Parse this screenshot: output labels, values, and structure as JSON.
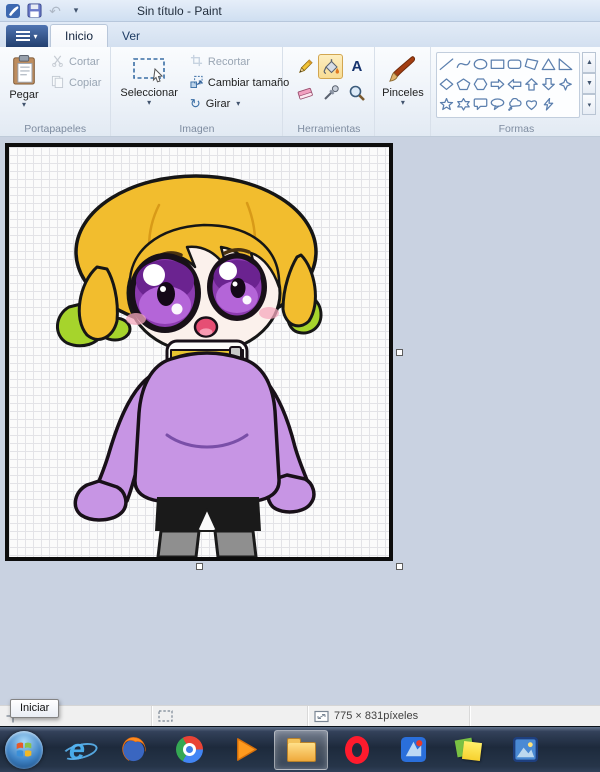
{
  "titlebar": {
    "title": "Sin título - Paint"
  },
  "ribbon": {
    "tabs": [
      {
        "label": "Inicio",
        "active": true
      },
      {
        "label": "Ver",
        "active": false
      }
    ],
    "clipboard": {
      "label": "Portapapeles",
      "paste": "Pegar",
      "cut": "Cortar",
      "copy": "Copiar"
    },
    "image": {
      "label": "Imagen",
      "select": "Seleccionar",
      "crop": "Recortar",
      "resize": "Cambiar tamaño",
      "rotate": "Girar"
    },
    "tools": {
      "label": "Herramientas",
      "items": [
        "pencil",
        "fill",
        "text",
        "eraser",
        "picker",
        "magnifier"
      ],
      "selected": "fill"
    },
    "brushes": {
      "label": "Pinceles"
    },
    "shapes": {
      "label": "Formas",
      "items": [
        "line",
        "curve",
        "oval",
        "rectangle",
        "rounded-rectangle",
        "polygon",
        "triangle",
        "right-triangle",
        "diamond",
        "pentagon",
        "hexagon",
        "arrow-right",
        "arrow-left",
        "arrow-up",
        "arrow-down",
        "star-4",
        "star-5",
        "star-6",
        "callout-rounded",
        "callout-oval",
        "callout-cloud",
        "heart",
        "lightning"
      ]
    }
  },
  "statusbar": {
    "image_size": "775 × 831píxeles"
  },
  "tooltip": {
    "text": "Iniciar"
  },
  "taskbar": {
    "icons": [
      "ie",
      "firefox",
      "chrome",
      "media-player",
      "explorer",
      "opera",
      "bluestacks",
      "sticky-notes",
      "photos"
    ],
    "active_icon": "explorer"
  }
}
